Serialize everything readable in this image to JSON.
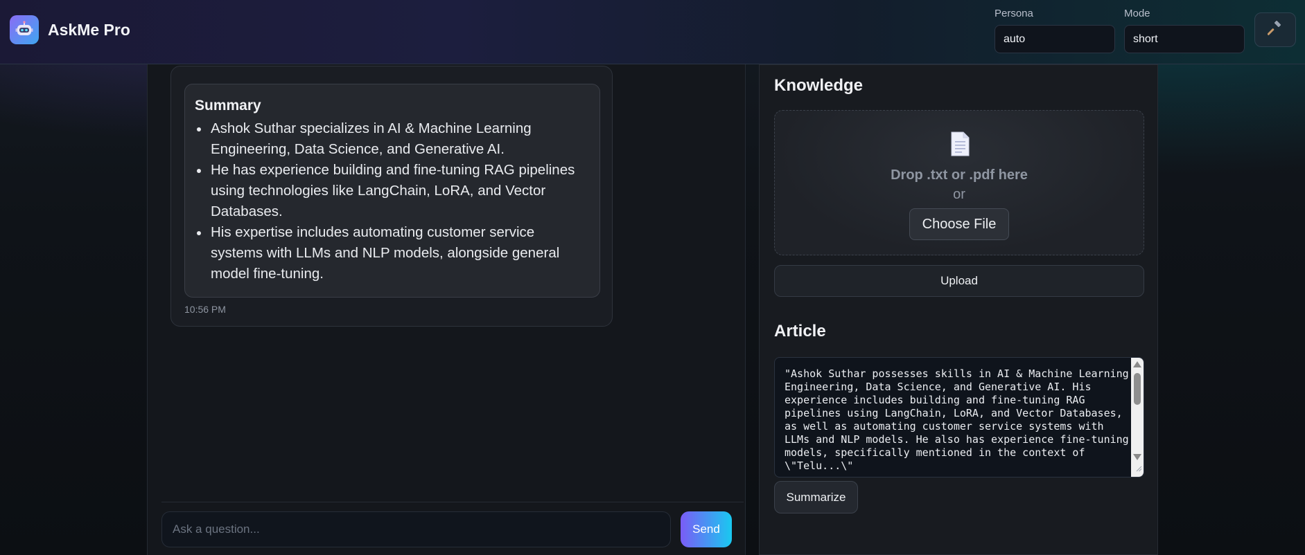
{
  "app": {
    "title": "AskMe Pro"
  },
  "header": {
    "persona": {
      "label": "Persona",
      "value": "auto"
    },
    "mode": {
      "label": "Mode",
      "value": "short"
    },
    "settings_icon": "hammer-icon"
  },
  "chat": {
    "message": {
      "heading": "Summary",
      "bullets": [
        "Ashok Suthar specializes in AI & Machine Learning Engineering, Data Science, and Generative AI.",
        "He has experience building and fine-tuning RAG pipelines using technologies like LangChain, LoRA, and Vector Databases.",
        "His expertise includes automating customer service systems with LLMs and NLP models, alongside general model fine-tuning."
      ],
      "time": "10:56 PM"
    },
    "input": {
      "placeholder": "Ask a question...",
      "value": ""
    },
    "send_label": "Send"
  },
  "knowledge": {
    "title": "Knowledge",
    "drop_text": "Drop .txt or .pdf here",
    "or_text": "or",
    "choose_label": "Choose File",
    "upload_label": "Upload"
  },
  "article": {
    "title": "Article",
    "text": "\"Ashok Suthar possesses skills in AI & Machine Learning Engineering, Data Science, and Generative AI. His experience includes building and fine-tuning RAG pipelines using LangChain, LoRA, and Vector Databases, as well as automating customer service systems with LLMs and NLP models. He also has experience fine-tuning models, specifically mentioned in the context of \\\"Telu...\\\"",
    "summarize_label": "Summarize"
  },
  "colors": {
    "accent_start": "#7a5cf6",
    "accent_end": "#19c9f0",
    "panel": "#181b20",
    "input_bg": "#0f141c"
  }
}
